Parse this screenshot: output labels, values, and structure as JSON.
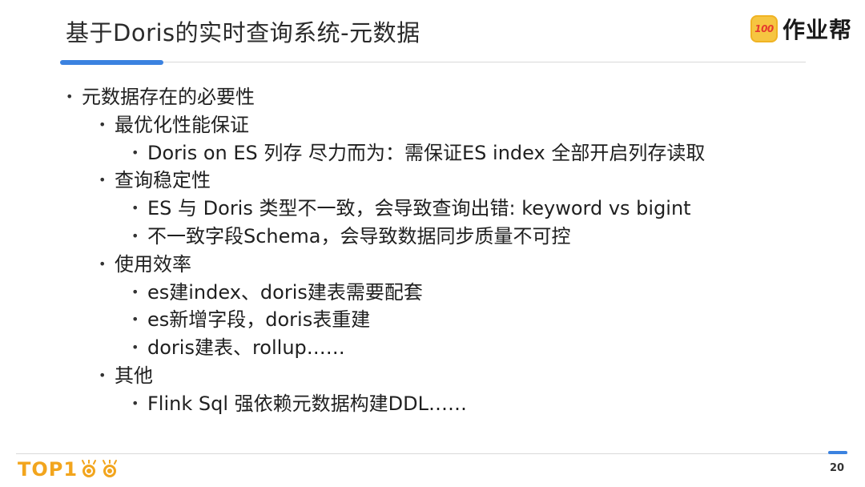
{
  "title": "基于Doris的实时查询系统-元数据",
  "brand": {
    "badge_text": "100",
    "name": "作业帮"
  },
  "bullets": [
    {
      "text": "元数据存在的必要性"
    },
    {
      "text": "最优化性能保证"
    },
    {
      "text": "Doris on ES 列存 尽力而为：需保证ES index 全部开启列存读取"
    },
    {
      "text": "查询稳定性"
    },
    {
      "text": "ES 与 Doris 类型不一致，会导致查询出错: keyword vs bigint"
    },
    {
      "text": "不一致字段Schema，会导致数据同步质量不可控"
    },
    {
      "text": "使用效率"
    },
    {
      "text": "es建index、doris建表需要配套"
    },
    {
      "text": "es新增字段，doris表重建"
    },
    {
      "text": "doris建表、rollup……"
    },
    {
      "text": "其他"
    },
    {
      "text": "Flink Sql 强依赖元数据构建DDL……"
    }
  ],
  "bullet_symbol": "•",
  "footer": {
    "logo_text": "TOP1",
    "page_number": "20"
  },
  "colors": {
    "accent": "#3b82e0",
    "logo": "#f2a51d",
    "badge": "#f6c541",
    "badge_text": "#e63b2e"
  }
}
